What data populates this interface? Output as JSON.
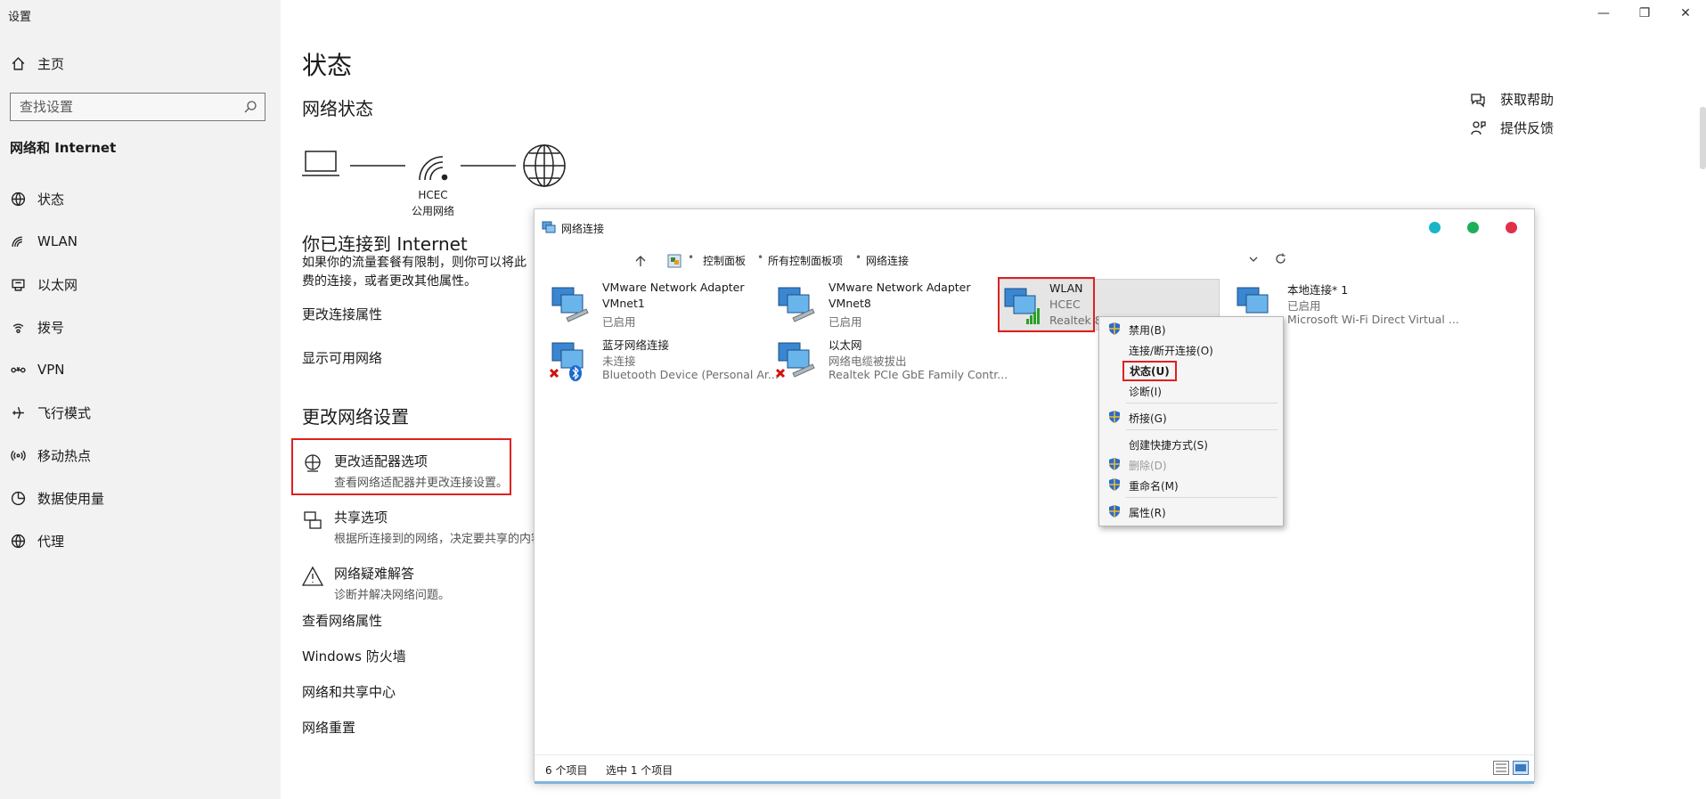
{
  "app": {
    "title": "设置"
  },
  "window_controls": {
    "minimize": "—",
    "restore": "❐",
    "close": "✕"
  },
  "sidebar": {
    "home_label": "主页",
    "search_placeholder": "查找设置",
    "section": "网络和 Internet",
    "items": [
      {
        "label": "状态",
        "icon": "globe-icon"
      },
      {
        "label": "WLAN",
        "icon": "wifi-icon"
      },
      {
        "label": "以太网",
        "icon": "ethernet-icon"
      },
      {
        "label": "拨号",
        "icon": "dialup-icon"
      },
      {
        "label": "VPN",
        "icon": "vpn-icon"
      },
      {
        "label": "飞行模式",
        "icon": "airplane-icon"
      },
      {
        "label": "移动热点",
        "icon": "hotspot-icon"
      },
      {
        "label": "数据使用量",
        "icon": "data-usage-icon"
      },
      {
        "label": "代理",
        "icon": "globe-icon"
      }
    ]
  },
  "main": {
    "title": "状态",
    "network_status": "网络状态",
    "diagram": {
      "network_name": "HCEC",
      "network_type": "公用网络"
    },
    "connected_title": "你已连接到 Internet",
    "connected_desc": "如果你的流量套餐有限制，则你可以将此网络设置为按流量计费的连接，或者更改其他属性。",
    "connected_desc_line1": "如果你的流量套餐有限制，则你可以将此",
    "connected_desc_line2": "费的连接，或者更改其他属性。",
    "links": {
      "change_props": "更改连接属性",
      "show_networks": "显示可用网络"
    },
    "change_settings_title": "更改网络设置",
    "options": [
      {
        "title": "更改适配器选项",
        "desc": "查看网络适配器并更改连接设置。"
      },
      {
        "title": "共享选项",
        "desc": "根据所连接到的网络，决定要共享的内容"
      },
      {
        "title": "网络疑难解答",
        "desc": "诊断并解决网络问题。"
      }
    ],
    "bottom_links": [
      "查看网络属性",
      "Windows 防火墙",
      "网络和共享中心",
      "网络重置"
    ]
  },
  "help": {
    "get_help": "获取帮助",
    "feedback": "提供反馈"
  },
  "nc_window": {
    "title": "网络连接",
    "breadcrumbs": [
      "控制面板",
      "所有控制面板项",
      "网络连接"
    ],
    "dot_colors": [
      "#19b5c8",
      "#1fae5a",
      "#e0304a"
    ],
    "items": [
      {
        "name": "VMware Network Adapter",
        "line2": "VMnet1",
        "line3": "已启用"
      },
      {
        "name": "VMware Network Adapter",
        "line2": "VMnet8",
        "line3": "已启用"
      },
      {
        "name": "WLAN",
        "line2": "HCEC",
        "line3": "Realtek 8"
      },
      {
        "name": "本地连接* 1",
        "line2": "已启用",
        "line3": "Microsoft Wi-Fi Direct Virtual ..."
      },
      {
        "name": "蓝牙网络连接",
        "line2": "未连接",
        "line3": "Bluetooth Device (Personal Ar..."
      },
      {
        "name": "以太网",
        "line2": "网络电缆被拔出",
        "line3": "Realtek PCIe GbE Family Contr..."
      }
    ],
    "status_count": "6 个项目",
    "status_selected": "选中 1 个项目"
  },
  "context_menu": {
    "items": [
      {
        "label": "禁用(B)",
        "shield": true
      },
      {
        "label": "连接/断开连接(O)",
        "shield": false
      },
      {
        "label": "状态(U)",
        "shield": false
      },
      {
        "label": "诊断(I)",
        "shield": false
      },
      {
        "label": "桥接(G)",
        "shield": true
      },
      {
        "label": "创建快捷方式(S)",
        "shield": false
      },
      {
        "label": "删除(D)",
        "shield": true
      },
      {
        "label": "重命名(M)",
        "shield": true
      },
      {
        "label": "属性(R)",
        "shield": true
      }
    ]
  }
}
